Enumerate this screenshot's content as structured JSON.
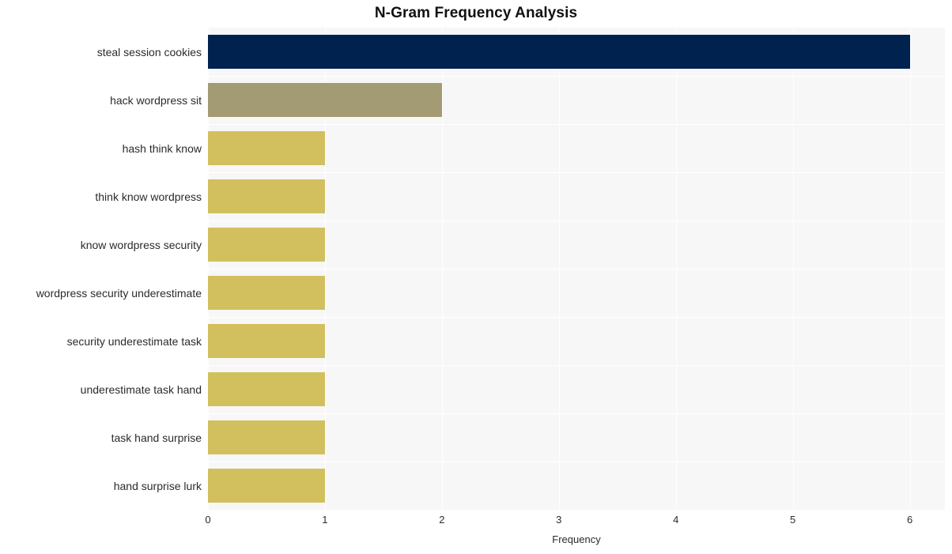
{
  "chart_data": {
    "type": "bar",
    "orientation": "horizontal",
    "title": "N-Gram Frequency Analysis",
    "xlabel": "Frequency",
    "ylabel": "",
    "xlim": [
      0,
      6.3
    ],
    "xticks": [
      "0",
      "1",
      "2",
      "3",
      "4",
      "5",
      "6"
    ],
    "xtick_values": [
      0,
      1,
      2,
      3,
      4,
      5,
      6
    ],
    "grid": true,
    "grid_color": "#ffffff",
    "plot_background": "#f7f7f7",
    "legend": "none",
    "categories": [
      "steal session cookies",
      "hack wordpress sit",
      "hash think know",
      "think know wordpress",
      "know wordpress security",
      "wordpress security underestimate",
      "security underestimate task",
      "underestimate task hand",
      "task hand surprise",
      "hand surprise lurk"
    ],
    "values": [
      6,
      2,
      1,
      1,
      1,
      1,
      1,
      1,
      1,
      1
    ],
    "bar_colors": [
      "#00224e",
      "#a39b73",
      "#d2c05e",
      "#d2c05e",
      "#d2c05e",
      "#d2c05e",
      "#d2c05e",
      "#d2c05e",
      "#d2c05e",
      "#d2c05e"
    ]
  }
}
